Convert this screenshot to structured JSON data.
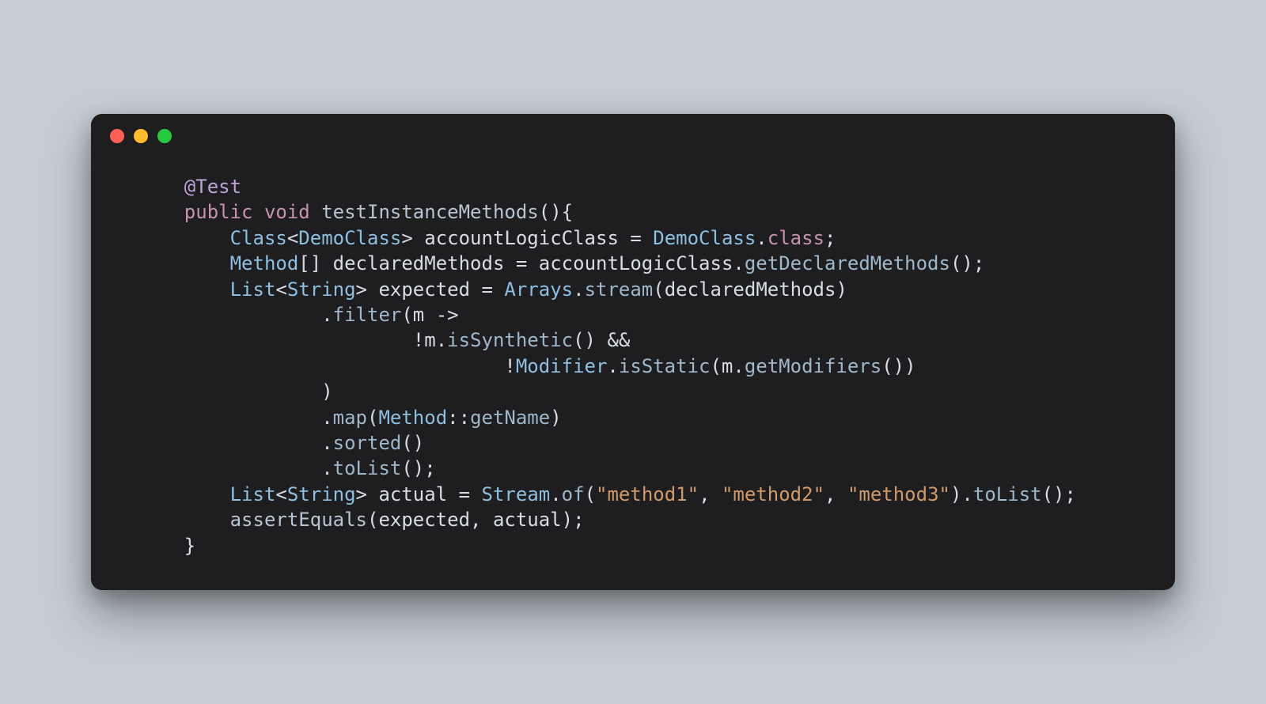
{
  "window": {
    "traffic_lights": [
      "close",
      "minimize",
      "zoom"
    ]
  },
  "code": {
    "tokens": [
      [
        {
          "t": "    ",
          "c": "punct"
        },
        {
          "t": "@Test",
          "c": "annotation"
        }
      ],
      [
        {
          "t": "    ",
          "c": "punct"
        },
        {
          "t": "public",
          "c": "keyword"
        },
        {
          "t": " ",
          "c": "punct"
        },
        {
          "t": "void",
          "c": "keyword"
        },
        {
          "t": " ",
          "c": "punct"
        },
        {
          "t": "testInstanceMethods",
          "c": "func"
        },
        {
          "t": "(){",
          "c": "punct"
        }
      ],
      [
        {
          "t": "        ",
          "c": "punct"
        },
        {
          "t": "Class",
          "c": "type"
        },
        {
          "t": "<",
          "c": "punct"
        },
        {
          "t": "DemoClass",
          "c": "type"
        },
        {
          "t": "> ",
          "c": "punct"
        },
        {
          "t": "accountLogicClass",
          "c": "ident"
        },
        {
          "t": " = ",
          "c": "op"
        },
        {
          "t": "DemoClass",
          "c": "type"
        },
        {
          "t": ".",
          "c": "punct"
        },
        {
          "t": "class",
          "c": "keyword"
        },
        {
          "t": ";",
          "c": "punct"
        }
      ],
      [
        {
          "t": "        ",
          "c": "punct"
        },
        {
          "t": "Method",
          "c": "type"
        },
        {
          "t": "[] ",
          "c": "punct"
        },
        {
          "t": "declaredMethods",
          "c": "ident"
        },
        {
          "t": " = ",
          "c": "op"
        },
        {
          "t": "accountLogicClass",
          "c": "ident"
        },
        {
          "t": ".",
          "c": "punct"
        },
        {
          "t": "getDeclaredMethods",
          "c": "member"
        },
        {
          "t": "();",
          "c": "punct"
        }
      ],
      [
        {
          "t": "        ",
          "c": "punct"
        },
        {
          "t": "List",
          "c": "type"
        },
        {
          "t": "<",
          "c": "punct"
        },
        {
          "t": "String",
          "c": "type"
        },
        {
          "t": "> ",
          "c": "punct"
        },
        {
          "t": "expected",
          "c": "ident"
        },
        {
          "t": " = ",
          "c": "op"
        },
        {
          "t": "Arrays",
          "c": "type"
        },
        {
          "t": ".",
          "c": "punct"
        },
        {
          "t": "stream",
          "c": "member"
        },
        {
          "t": "(",
          "c": "punct"
        },
        {
          "t": "declaredMethods",
          "c": "ident"
        },
        {
          "t": ")",
          "c": "punct"
        }
      ],
      [
        {
          "t": "                .",
          "c": "punct"
        },
        {
          "t": "filter",
          "c": "member"
        },
        {
          "t": "(",
          "c": "punct"
        },
        {
          "t": "m",
          "c": "ident"
        },
        {
          "t": " -> ",
          "c": "op"
        }
      ],
      [
        {
          "t": "                        !",
          "c": "punct"
        },
        {
          "t": "m",
          "c": "ident"
        },
        {
          "t": ".",
          "c": "punct"
        },
        {
          "t": "isSynthetic",
          "c": "member"
        },
        {
          "t": "() &&",
          "c": "punct"
        }
      ],
      [
        {
          "t": "                                !",
          "c": "punct"
        },
        {
          "t": "Modifier",
          "c": "type"
        },
        {
          "t": ".",
          "c": "punct"
        },
        {
          "t": "isStatic",
          "c": "member"
        },
        {
          "t": "(",
          "c": "punct"
        },
        {
          "t": "m",
          "c": "ident"
        },
        {
          "t": ".",
          "c": "punct"
        },
        {
          "t": "getModifiers",
          "c": "member"
        },
        {
          "t": "())",
          "c": "punct"
        }
      ],
      [
        {
          "t": "                )",
          "c": "punct"
        }
      ],
      [
        {
          "t": "                .",
          "c": "punct"
        },
        {
          "t": "map",
          "c": "member"
        },
        {
          "t": "(",
          "c": "punct"
        },
        {
          "t": "Method",
          "c": "type"
        },
        {
          "t": "::",
          "c": "punct"
        },
        {
          "t": "getName",
          "c": "member"
        },
        {
          "t": ")",
          "c": "punct"
        }
      ],
      [
        {
          "t": "                .",
          "c": "punct"
        },
        {
          "t": "sorted",
          "c": "member"
        },
        {
          "t": "()",
          "c": "punct"
        }
      ],
      [
        {
          "t": "                .",
          "c": "punct"
        },
        {
          "t": "toList",
          "c": "member"
        },
        {
          "t": "();",
          "c": "punct"
        }
      ],
      [
        {
          "t": "        ",
          "c": "punct"
        },
        {
          "t": "List",
          "c": "type"
        },
        {
          "t": "<",
          "c": "punct"
        },
        {
          "t": "String",
          "c": "type"
        },
        {
          "t": "> ",
          "c": "punct"
        },
        {
          "t": "actual",
          "c": "ident"
        },
        {
          "t": " = ",
          "c": "op"
        },
        {
          "t": "Stream",
          "c": "type"
        },
        {
          "t": ".",
          "c": "punct"
        },
        {
          "t": "of",
          "c": "member"
        },
        {
          "t": "(",
          "c": "punct"
        },
        {
          "t": "\"method1\"",
          "c": "string"
        },
        {
          "t": ", ",
          "c": "punct"
        },
        {
          "t": "\"method2\"",
          "c": "string"
        },
        {
          "t": ", ",
          "c": "punct"
        },
        {
          "t": "\"method3\"",
          "c": "string"
        },
        {
          "t": ").",
          "c": "punct"
        },
        {
          "t": "toList",
          "c": "member"
        },
        {
          "t": "();",
          "c": "punct"
        }
      ],
      [
        {
          "t": "        ",
          "c": "punct"
        },
        {
          "t": "assertEquals",
          "c": "func"
        },
        {
          "t": "(",
          "c": "punct"
        },
        {
          "t": "expected",
          "c": "ident"
        },
        {
          "t": ", ",
          "c": "punct"
        },
        {
          "t": "actual",
          "c": "ident"
        },
        {
          "t": ");",
          "c": "punct"
        }
      ],
      [
        {
          "t": "    }",
          "c": "punct"
        }
      ]
    ]
  }
}
